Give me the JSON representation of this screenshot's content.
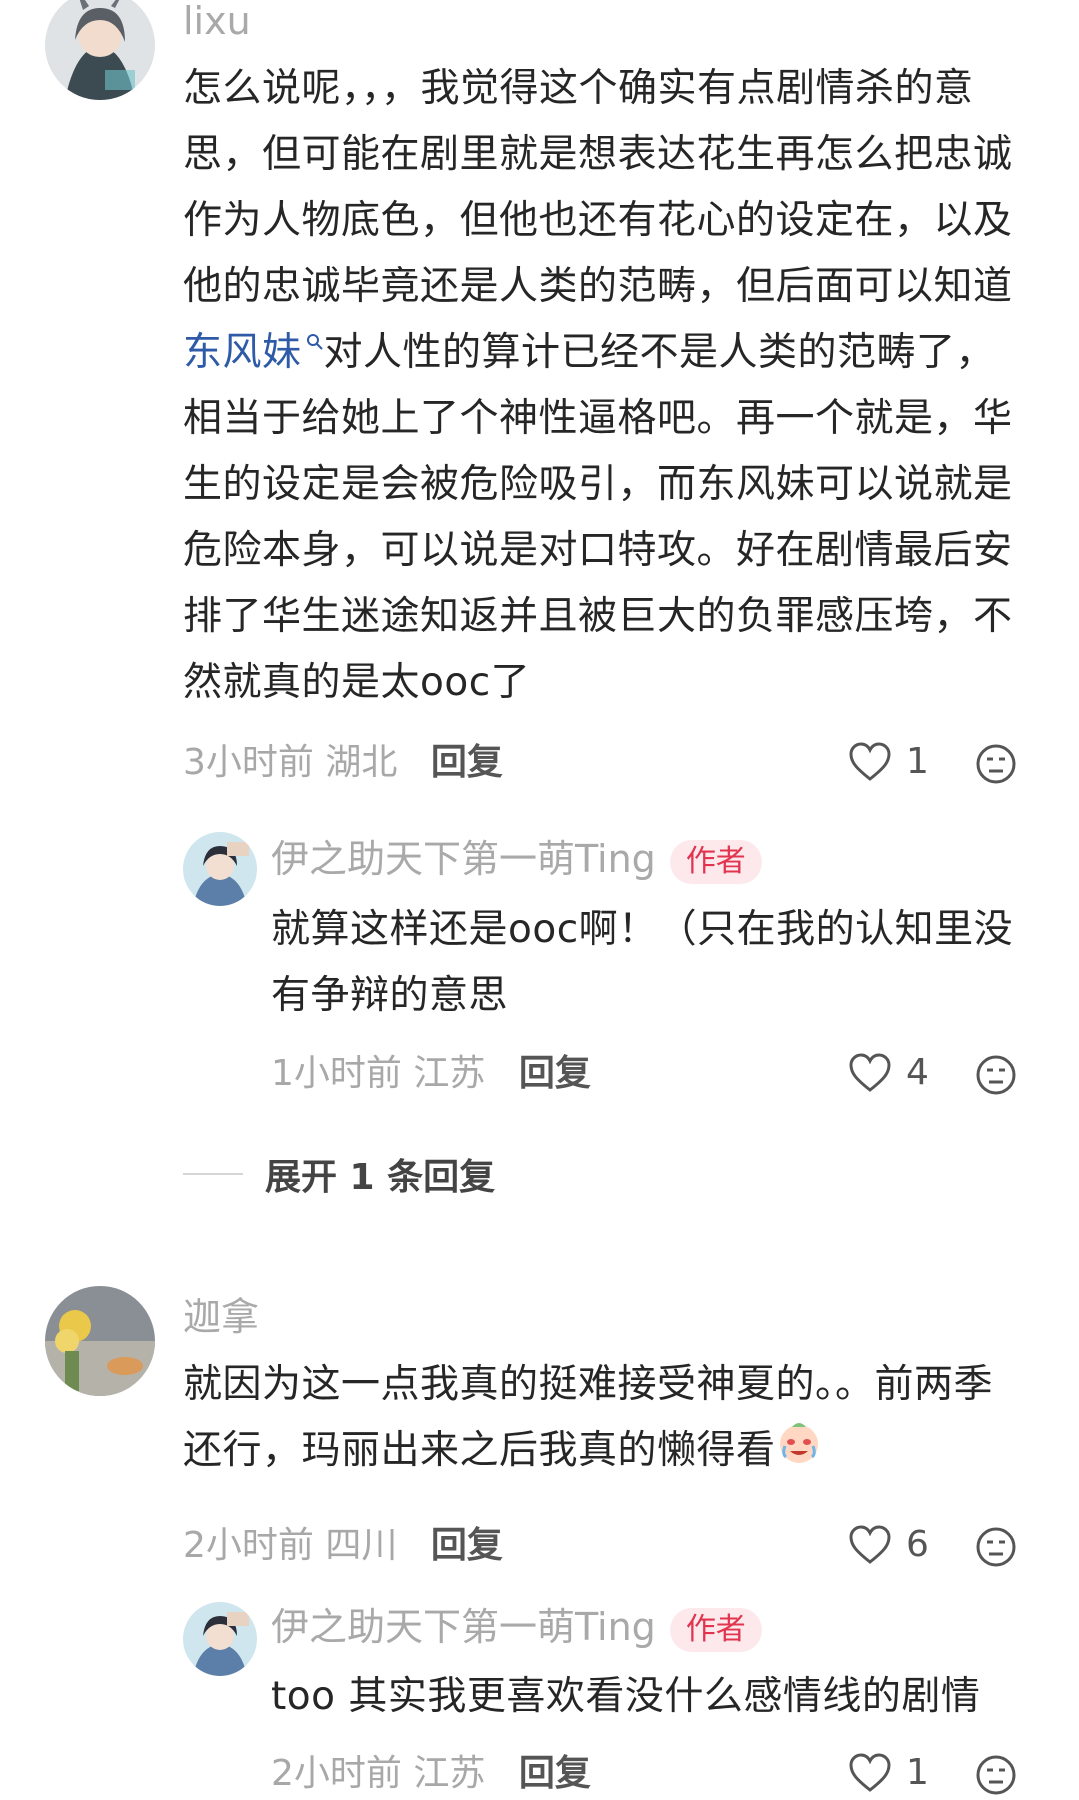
{
  "comments": [
    {
      "user": "lixu",
      "text_before_link": "怎么说呢，，，我觉得这个确实有点剧情杀的意思，但可能在剧里就是想表达花生再怎么把忠诚作为人物底色，但他也还有花心的设定在，以及他的忠诚毕竟还是人类的范畴，但后面可以知道",
      "link": "东风妹",
      "text_after_link": "对人性的算计已经不是人类的范畴了，相当于给她上了个神性逼格吧。再一个就是，华生的设定是会被危险吸引，而东风妹可以说就是危险本身，可以说是对口特攻。好在剧情最后安排了华生迷途知返并且被巨大的负罪感压垮，不然就真的是太ooc了",
      "time": "3小时前",
      "location": "湖北",
      "reply_label": "回复",
      "likes": "1",
      "replies": [
        {
          "user": "伊之助天下第一萌Ting",
          "tag": "作者",
          "text": "就算这样还是ooc啊！（只在我的认知里没有争辩的意思",
          "time": "1小时前",
          "location": "江苏",
          "reply_label": "回复",
          "likes": "4"
        }
      ],
      "expand_label": "展开 1 条回复"
    },
    {
      "user": "迦拿",
      "text": "就因为这一点我真的挺难接受神夏的。。前两季还行，玛丽出来之后我真的懒得看",
      "emoji": "crying-face-emoji",
      "time": "2小时前",
      "location": "四川",
      "reply_label": "回复",
      "likes": "6",
      "replies": [
        {
          "user": "伊之助天下第一萌Ting",
          "tag": "作者",
          "text": "too 其实我更喜欢看没什么感情线的剧情",
          "time": "2小时前",
          "location": "江苏",
          "reply_label": "回复",
          "likes": "1"
        }
      ]
    }
  ],
  "colors": {
    "link": "#2f5aa7",
    "author_tag_bg": "#fde9ec",
    "author_tag_text": "#e0344f"
  }
}
